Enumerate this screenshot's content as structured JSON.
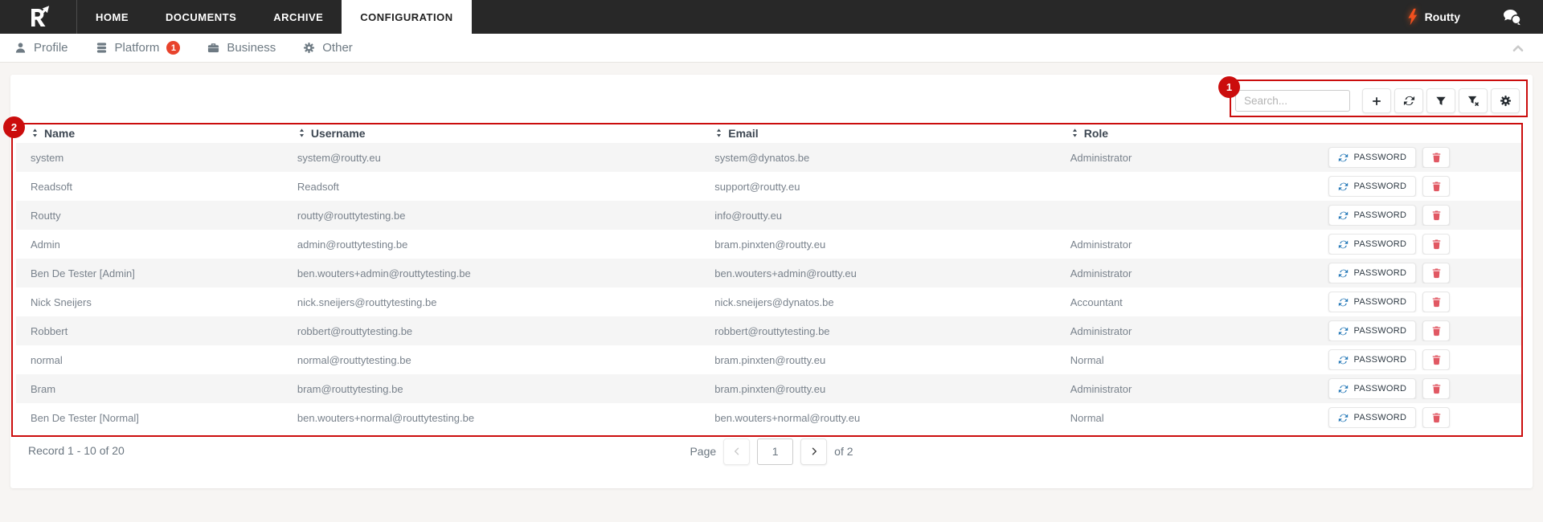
{
  "navbar": {
    "tabs": [
      {
        "label": "HOME"
      },
      {
        "label": "DOCUMENTS"
      },
      {
        "label": "ARCHIVE"
      },
      {
        "label": "CONFIGURATION",
        "active": true
      }
    ],
    "brand": "Routty"
  },
  "subnav": {
    "items": [
      {
        "label": "Profile"
      },
      {
        "label": "Platform",
        "badge": "1"
      },
      {
        "label": "Business"
      },
      {
        "label": "Other"
      }
    ]
  },
  "toolbar": {
    "search_placeholder": "Search...",
    "buttons": [
      "add",
      "refresh",
      "filter",
      "clear-filter",
      "settings"
    ]
  },
  "table": {
    "columns": [
      "Name",
      "Username",
      "Email",
      "Role"
    ],
    "password_label": "PASSWORD",
    "rows": [
      {
        "name": "system",
        "username": "system@routty.eu",
        "email": "system@dynatos.be",
        "role": "Administrator"
      },
      {
        "name": "Readsoft",
        "username": "Readsoft",
        "email": "support@routty.eu",
        "role": ""
      },
      {
        "name": "Routty",
        "username": "routty@routtytesting.be",
        "email": "info@routty.eu",
        "role": ""
      },
      {
        "name": "Admin",
        "username": "admin@routtytesting.be",
        "email": "bram.pinxten@routty.eu",
        "role": "Administrator"
      },
      {
        "name": "Ben De Tester [Admin]",
        "username": "ben.wouters+admin@routtytesting.be",
        "email": "ben.wouters+admin@routty.eu",
        "role": "Administrator"
      },
      {
        "name": "Nick Sneijers",
        "username": "nick.sneijers@routtytesting.be",
        "email": "nick.sneijers@dynatos.be",
        "role": "Accountant"
      },
      {
        "name": "Robbert",
        "username": "robbert@routtytesting.be",
        "email": "robbert@routtytesting.be",
        "role": "Administrator"
      },
      {
        "name": "normal",
        "username": "normal@routtytesting.be",
        "email": "bram.pinxten@routty.eu",
        "role": "Normal"
      },
      {
        "name": "Bram",
        "username": "bram@routtytesting.be",
        "email": "bram.pinxten@routty.eu",
        "role": "Administrator"
      },
      {
        "name": "Ben De Tester [Normal]",
        "username": "ben.wouters+normal@routtytesting.be",
        "email": "ben.wouters+normal@routty.eu",
        "role": "Normal"
      }
    ]
  },
  "footer": {
    "record_text": "Record 1 - 10 of 20",
    "page_label": "Page",
    "page_value": "1",
    "page_total": "of 2"
  },
  "annotations": {
    "circle1": "1",
    "circle2": "2"
  },
  "colors": {
    "navbar_bg": "#282828",
    "accent_red": "#cb0d0d",
    "badge_red": "#e8432c",
    "bolt_orange": "#f2501e",
    "refresh_blue": "#2679b8",
    "trash_red": "#e15863"
  }
}
